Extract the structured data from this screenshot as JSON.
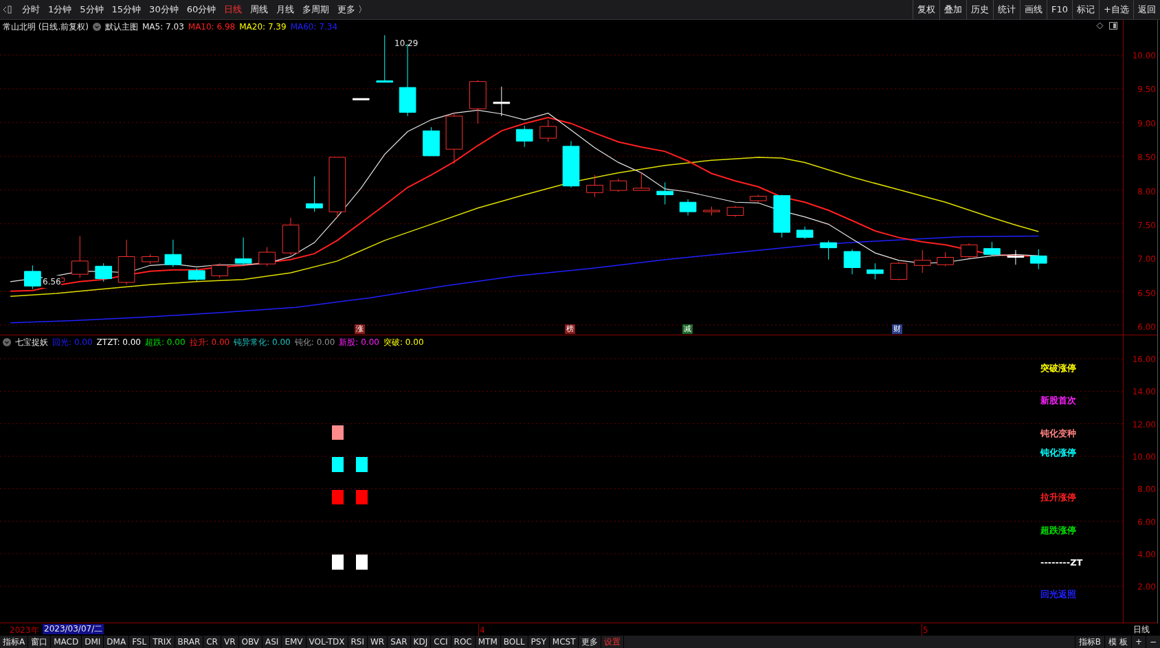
{
  "toolbar": {
    "periods": [
      {
        "label": "分时",
        "selected": false
      },
      {
        "label": "1分钟",
        "selected": false
      },
      {
        "label": "5分钟",
        "selected": false
      },
      {
        "label": "15分钟",
        "selected": false
      },
      {
        "label": "30分钟",
        "selected": false
      },
      {
        "label": "60分钟",
        "selected": false
      },
      {
        "label": "日线",
        "selected": true
      },
      {
        "label": "周线",
        "selected": false
      },
      {
        "label": "月线",
        "selected": false
      },
      {
        "label": "多周期",
        "selected": false
      },
      {
        "label": "更多 〉",
        "selected": false
      }
    ],
    "actions": [
      "复权",
      "叠加",
      "历史",
      "统计",
      "画线",
      "F10",
      "标记",
      "+自选",
      "返回"
    ]
  },
  "main_legend": {
    "title": "常山北明 (日线.前复权)",
    "chart_name": "默认主图",
    "items": [
      {
        "text": "MA5: 7.03",
        "color": "#e6e6e6"
      },
      {
        "text": "MA10: 6.98",
        "color": "#ff2020"
      },
      {
        "text": "MA20: 7.39",
        "color": "#ffff00"
      },
      {
        "text": "MA60: 7.34",
        "color": "#2020ff"
      }
    ]
  },
  "main_chart": {
    "high_label": "10.29",
    "low_label": "6.56",
    "price_axis": [
      "10.00",
      "9.50",
      "9.00",
      "8.50",
      "8.00",
      "7.50",
      "7.00",
      "6.50",
      "6.00"
    ],
    "event_marks": [
      {
        "text": "涨",
        "color": "#8b1c1c"
      },
      {
        "text": "榜",
        "color": "#8b1c1c"
      },
      {
        "text": "减",
        "color": "#1f6b2a"
      },
      {
        "text": "财",
        "color": "#2b3f8a"
      }
    ]
  },
  "indicator_legend": {
    "title": "七宝捉妖",
    "items": [
      {
        "label": "回光:",
        "value": "0.00",
        "color": "#2020ff"
      },
      {
        "label": "ZTZT:",
        "value": "0.00",
        "color": "#ffffff"
      },
      {
        "label": "超跌:",
        "value": "0.00",
        "color": "#00e000"
      },
      {
        "label": "拉升:",
        "value": "0.00",
        "color": "#ff2020"
      },
      {
        "label": "钝异常化:",
        "value": "0.00",
        "color": "#20c0c0"
      },
      {
        "label": "钝化:",
        "value": "0.00",
        "color": "#909090"
      },
      {
        "label": "新股:",
        "value": "0.00",
        "color": "#ff20ff"
      },
      {
        "label": "突破:",
        "value": "0.00",
        "color": "#ffff00"
      }
    ]
  },
  "indicator_chart": {
    "axis": [
      "16.00",
      "14.00",
      "12.00",
      "10.00",
      "8.00",
      "6.00",
      "4.00",
      "2.00"
    ],
    "labels": [
      {
        "text": "突破涨停",
        "color": "#ffff00"
      },
      {
        "text": "新股首次",
        "color": "#ff20ff"
      },
      {
        "text": "钝化变种",
        "color": "#ff8080"
      },
      {
        "text": "钝化涨停",
        "color": "#00ffff"
      },
      {
        "text": "拉升涨停",
        "color": "#ff2020"
      },
      {
        "text": "超跌涨停",
        "color": "#00e000"
      },
      {
        "text": "--------ZT",
        "color": "#ffffff"
      },
      {
        "text": "回光返照",
        "color": "#2020ff"
      }
    ]
  },
  "date_axis": {
    "year": "2023年",
    "cursor_date": "2023/03/07/二",
    "months": [
      "4",
      "5"
    ],
    "period": "日线"
  },
  "bottom_tabs": [
    {
      "label": "指标A",
      "kind": "normal"
    },
    {
      "label": "窗口",
      "kind": "normal"
    },
    {
      "label": "MACD",
      "kind": "normal"
    },
    {
      "label": "DMI",
      "kind": "normal"
    },
    {
      "label": "DMA",
      "kind": "normal"
    },
    {
      "label": "FSL",
      "kind": "normal"
    },
    {
      "label": "TRIX",
      "kind": "normal"
    },
    {
      "label": "BRAR",
      "kind": "normal"
    },
    {
      "label": "CR",
      "kind": "normal"
    },
    {
      "label": "VR",
      "kind": "normal"
    },
    {
      "label": "OBV",
      "kind": "normal"
    },
    {
      "label": "ASI",
      "kind": "normal"
    },
    {
      "label": "EMV",
      "kind": "normal"
    },
    {
      "label": "VOL-TDX",
      "kind": "normal"
    },
    {
      "label": "RSI",
      "kind": "normal"
    },
    {
      "label": "WR",
      "kind": "normal"
    },
    {
      "label": "SAR",
      "kind": "normal"
    },
    {
      "label": "KDJ",
      "kind": "normal"
    },
    {
      "label": "CCI",
      "kind": "normal"
    },
    {
      "label": "ROC",
      "kind": "normal"
    },
    {
      "label": "MTM",
      "kind": "normal"
    },
    {
      "label": "BOLL",
      "kind": "normal"
    },
    {
      "label": "PSY",
      "kind": "normal"
    },
    {
      "label": "MCST",
      "kind": "normal"
    },
    {
      "label": "更多",
      "kind": "normal"
    },
    {
      "label": "设置",
      "kind": "settings"
    }
  ],
  "bottom_right": [
    "指标B",
    "模 板",
    "+",
    "−"
  ]
}
